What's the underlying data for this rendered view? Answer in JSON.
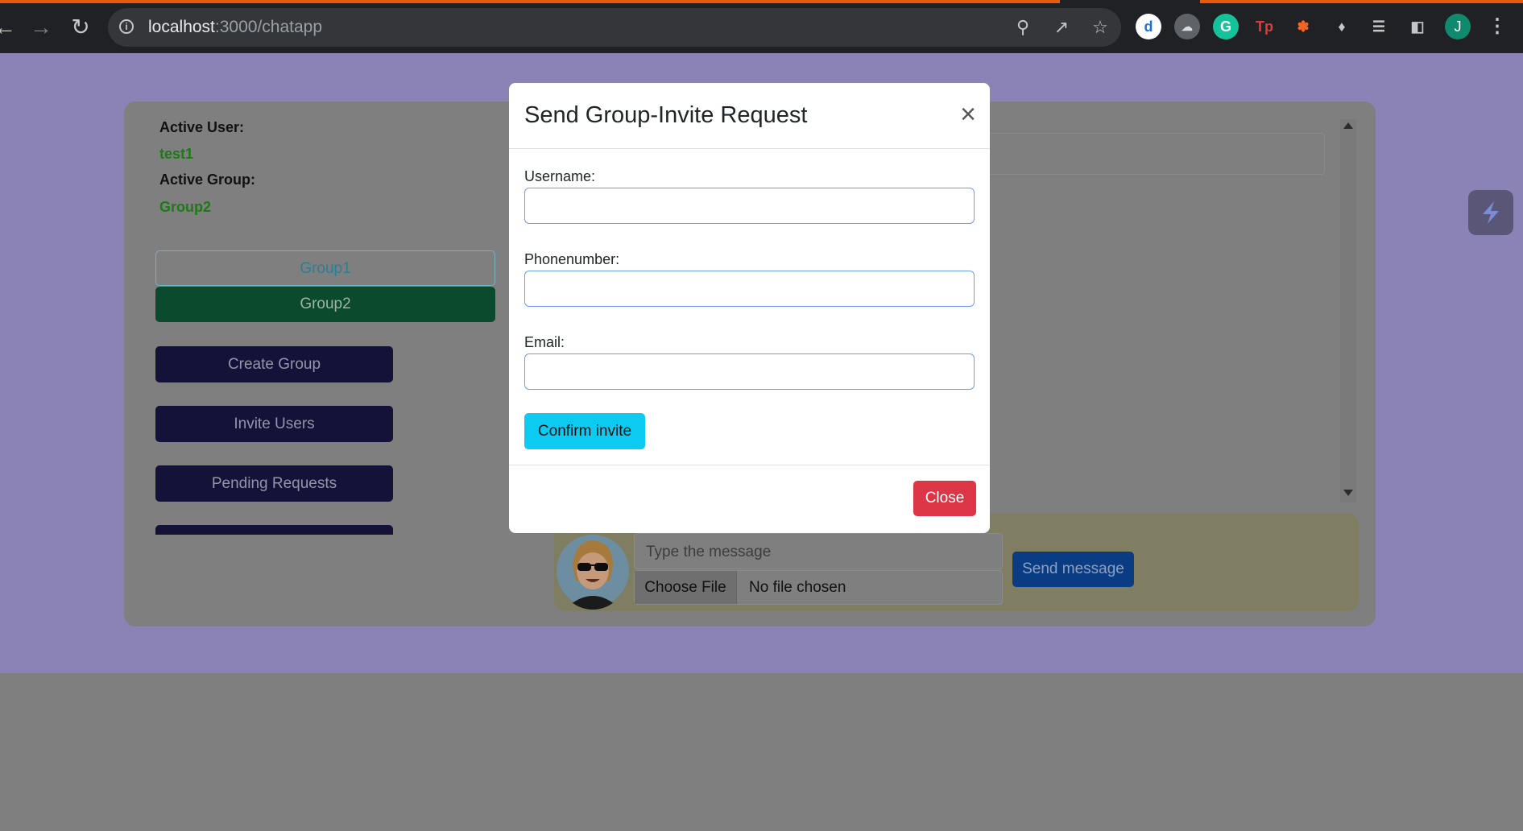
{
  "browser": {
    "url_host": "localhost",
    "url_path": ":3000/chatapp",
    "profile_initial": "J",
    "colors": {
      "accent": "#e8590c"
    }
  },
  "sidebar": {
    "active_user_label": "Active User:",
    "active_user_value": "test1",
    "active_group_label": "Active Group:",
    "active_group_value": "Group2",
    "groups": [
      {
        "label": "Group1",
        "selected": false
      },
      {
        "label": "Group2",
        "selected": true
      }
    ],
    "actions": [
      {
        "label": "Create Group"
      },
      {
        "label": "Invite Users"
      },
      {
        "label": "Pending Requests"
      }
    ]
  },
  "composer": {
    "message_placeholder": "Type the message",
    "choose_file_label": "Choose File",
    "no_file_text": "No file chosen",
    "send_label": "Send message"
  },
  "modal": {
    "title": "Send Group-Invite Request",
    "close_icon": "close-icon",
    "fields": [
      {
        "label": "Username:",
        "value": ""
      },
      {
        "label": "Phonenumber:",
        "value": ""
      },
      {
        "label": "Email:",
        "value": ""
      }
    ],
    "confirm_label": "Confirm invite",
    "close_label": "Close",
    "colors": {
      "confirm": "#0dcaf0",
      "close": "#dc3545"
    }
  }
}
